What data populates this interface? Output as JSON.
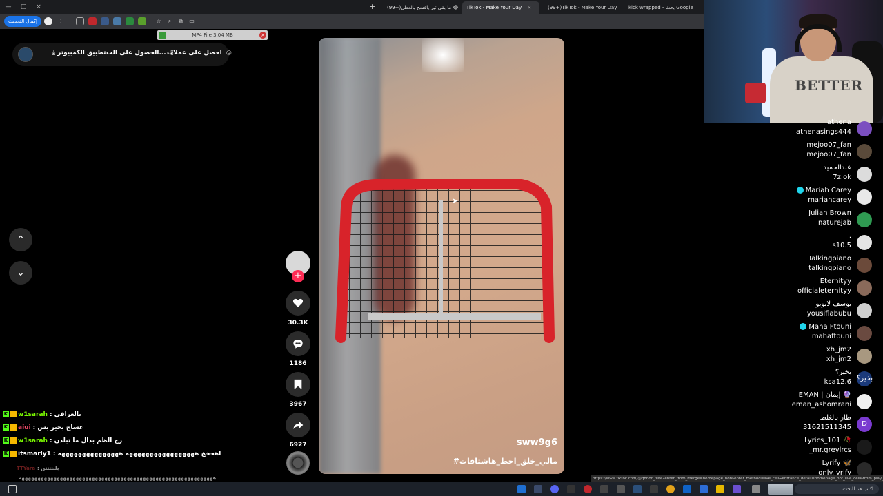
{
  "browser": {
    "tabs": [
      {
        "label": "kick wrapped - بحث Google",
        "active": false
      },
      {
        "label": "(99+)TikTok - Make Your Day",
        "active": false
      },
      {
        "label": "TikTok - Make Your Day",
        "active": true
      },
      {
        "label": "(99+)ما بقى تير يافسح بالعطل 😂",
        "active": false
      }
    ],
    "update_button": "إكمال التحديث",
    "new_tab": "+",
    "close_tab": "×"
  },
  "download": {
    "label": "MP4 File 3.04 MB",
    "close": "×"
  },
  "tiktok_bar": {
    "coins": "احصل على عملات",
    "get_app": "الحصول على الت...",
    "desktop_app": "تطبيق الكمبيوتر"
  },
  "nav": {
    "up": "⌃",
    "down": "⌄"
  },
  "video": {
    "username": "sww9g6",
    "caption": "#مالي_خلق_احط_هاشتاقات"
  },
  "actions": {
    "follow": "+",
    "likes": "30.3K",
    "comments": "1186",
    "saves": "3967",
    "shares": "6927"
  },
  "webcam": {
    "shirt_text": "BETTER"
  },
  "live_list": [
    {
      "name": "athena",
      "handle": "athenasings444",
      "color": "#7b4fc0",
      "avatar_text": "",
      "verified": false
    },
    {
      "name": "mejoo07_fan",
      "handle": "mejoo07_fan",
      "color": "#5a4a3a",
      "avatar_text": "",
      "verified": false
    },
    {
      "name": "عبدالحميد",
      "handle": "7z.ok",
      "color": "#dcdcdc",
      "avatar_text": "",
      "verified": false
    },
    {
      "name": "Mariah Carey",
      "handle": "mariahcarey",
      "color": "#e8e8e8",
      "avatar_text": "",
      "verified": true
    },
    {
      "name": "Julian Brown",
      "handle": "naturejab",
      "color": "#2f9a52",
      "avatar_text": "",
      "verified": false
    },
    {
      "name": ".",
      "handle": "s10.5",
      "color": "#e4e4e4",
      "avatar_text": "",
      "verified": false
    },
    {
      "name": "Talkingpiano",
      "handle": "talkingpiano",
      "color": "#6b4a3a",
      "avatar_text": "",
      "verified": false
    },
    {
      "name": "Eternityy",
      "handle": "officialeternityy",
      "color": "#8a6a5a",
      "avatar_text": "",
      "verified": false
    },
    {
      "name": "يوسف لابوبو",
      "handle": "yousiflabubu",
      "color": "#d0d0d0",
      "avatar_text": "",
      "verified": false
    },
    {
      "name": "Maha Ftouni",
      "handle": "mahaftouni",
      "color": "#6a4a40",
      "avatar_text": "",
      "verified": true
    },
    {
      "name": "xh_jm2",
      "handle": "xh_jm2",
      "color": "#a89880",
      "avatar_text": "",
      "verified": false
    },
    {
      "name": "بخير؟",
      "handle": "ksa12.6",
      "color": "#1b3a7a",
      "avatar_text": "بخير؟",
      "verified": false
    },
    {
      "name": "EMAN | إيمان 🔮",
      "handle": "eman_ashomrani",
      "color": "#f0f0f0",
      "avatar_text": "",
      "verified": false
    },
    {
      "name": "طار بالغلط",
      "handle": "31621511345",
      "color": "#7a3ad0",
      "avatar_text": "D",
      "verified": false
    },
    {
      "name": "Lyrics_101 🥀",
      "handle": "_mr.greylrcs",
      "color": "#1a1a1a",
      "avatar_text": "",
      "verified": false
    },
    {
      "name": "Lyrify 🦋",
      "handle": "only.lyrify",
      "color": "#2a2a2a",
      "avatar_text": "",
      "verified": false
    }
  ],
  "chat": [
    {
      "user": "w1sarah",
      "color": "#7cfc00",
      "message": ": يالعراقي"
    },
    {
      "user": "aiui",
      "color": "#ff4d6d",
      "message": ": عساج بخير بس"
    },
    {
      "user": "w1sarah",
      "color": "#7cfc00",
      "message": ": رح الظم بدال ما تبلدن"
    },
    {
      "user": "itsmarly1",
      "color": "#ffffff",
      "message": ": اهخخخ هههههههههههههههههه هههههههههههههههه"
    },
    {
      "user": "TTYara",
      "color": "#b03030",
      "message": ": بلبتتتتن"
    },
    {
      "user": "",
      "color": "#ffffff",
      "message": "هههههههههههههههههههههههههههههههههههههههههههههههههههههههههههههه"
    }
  ],
  "status_url": "https://www.tiktok.com/@q8bdr_/live?enter_from_merge=homepage_hot&enter_method=live_cell&entrance_detail=homepage_hot_live_cell&from_play_mo...",
  "taskbar": {
    "search": "اكتب هنا للبحث"
  }
}
